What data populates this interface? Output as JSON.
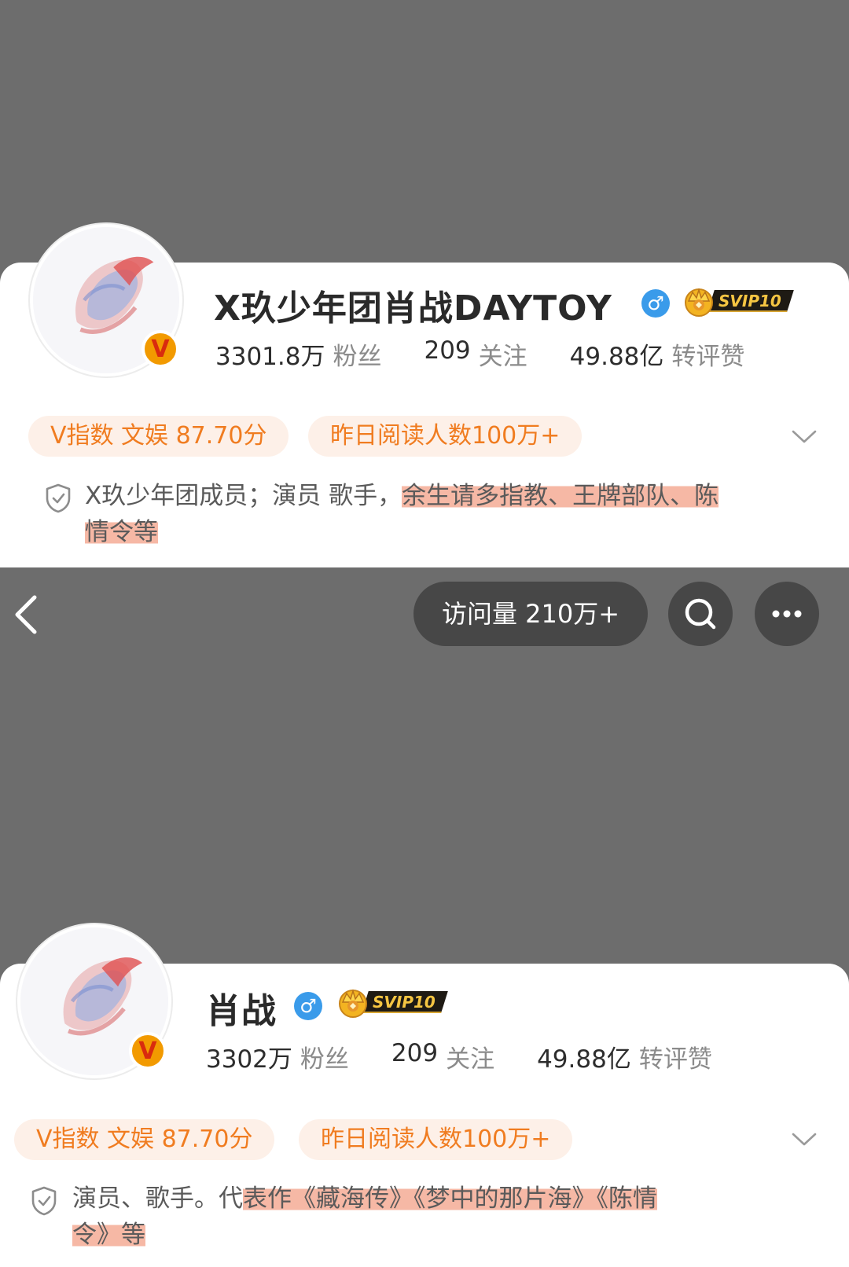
{
  "profile_1": {
    "name": "X玖少年团肖战DAYTOY",
    "gender_symbol": "♂",
    "svip_label": "SVIP10",
    "verified_badge": "V",
    "stats": [
      {
        "value": "3301.8万",
        "label": "粉丝"
      },
      {
        "value": "209",
        "label": "关注"
      },
      {
        "value": "49.88亿",
        "label": "转评赞"
      }
    ],
    "pills": [
      "V指数 文娱 87.70分",
      "昨日阅读人数100万+"
    ],
    "bio_plain": "X玖少年团成员；演员 歌手，",
    "bio_highlight_1": "余生请多指教、王牌部队、陈",
    "bio_highlight_2": "情令等"
  },
  "nav_bar": {
    "visits_label": "访问量 210万+",
    "icons": [
      "back-arrow-icon",
      "search-icon",
      "more-icon"
    ]
  },
  "profile_2": {
    "name": "肖战",
    "gender_symbol": "♂",
    "svip_label": "SVIP10",
    "verified_badge": "V",
    "stats": [
      {
        "value": "3302万",
        "label": "粉丝"
      },
      {
        "value": "209",
        "label": "关注"
      },
      {
        "value": "49.88亿",
        "label": "转评赞"
      }
    ],
    "pills": [
      "V指数 文娱 87.70分",
      "昨日阅读人数100万+"
    ],
    "bio_plain": "演员、歌手。代",
    "bio_highlight_1": "表作《藏海传》《梦中的那片海》《陈情",
    "bio_highlight_2": "令》等"
  },
  "colors": {
    "background": "#6d6d6d",
    "pill_text": "#f07c20",
    "pill_bg": "#fdf0e8",
    "highlight": "#f08c6e",
    "verified_orange": "#f29a00",
    "gender_blue": "#3a9bea"
  }
}
